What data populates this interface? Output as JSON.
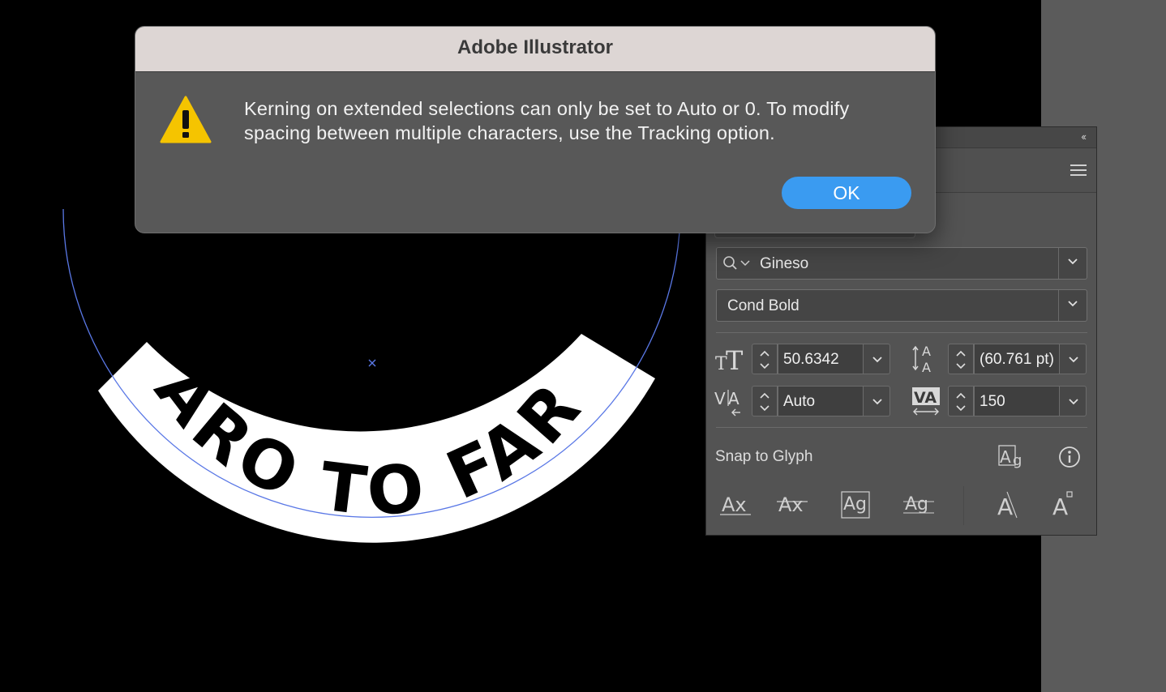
{
  "dialog": {
    "title": "Adobe Illustrator",
    "icon": "warning-icon",
    "message": "Kerning on extended selections can only be set to Auto or 0. To modify spacing between multiple characters, use the Tracking option.",
    "ok_label": "OK",
    "accent_color": "#3a9bf1",
    "warning_color": "#f5c400"
  },
  "artwork": {
    "text_on_path": "FARO TO FARO",
    "path_color": "#5a78e6"
  },
  "character_panel": {
    "font_family": "Gineso",
    "font_style": "Cond Bold",
    "font_size": "50.6342",
    "leading": "(60.761 pt)",
    "kerning": "Auto",
    "tracking": "150",
    "snap_label": "Snap to Glyph",
    "icons": {
      "font_size": "font-size-icon",
      "leading": "leading-icon",
      "kerning": "kerning-icon",
      "tracking": "tracking-icon",
      "search": "search-icon",
      "menu": "menu-icon",
      "collapse": "double-chevron-left-icon",
      "glyph_bounds": "glyph-bounds-icon",
      "info": "info-icon",
      "snap_options": [
        "baseline-snap-icon",
        "x-height-snap-icon",
        "glyph-bounds-snap-icon",
        "proximity-guides-icon",
        "angular-guides-icon",
        "anchor-point-icon"
      ]
    }
  }
}
